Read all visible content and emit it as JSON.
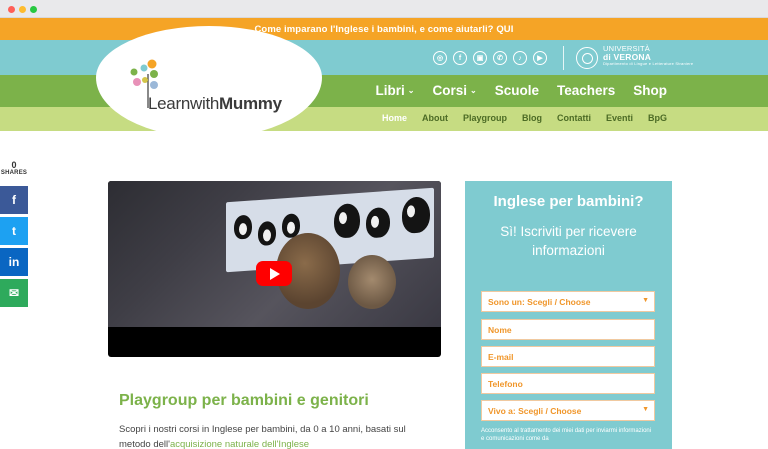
{
  "announcement": {
    "text": "Come imparano l'Inglese i bambini, e come aiutarli? QUI"
  },
  "logo": {
    "word1": "Learn",
    "word2": "with",
    "word3": "Mummy"
  },
  "social_icons": [
    "instagram-icon",
    "facebook-icon",
    "instagram-icon",
    "phone-icon",
    "tiktok-icon",
    "youtube-icon"
  ],
  "university": {
    "line1": "UNIVERSITÀ",
    "line2": "di VERONA",
    "line3": "Dipartimento di Lingue e Letterature Straniere"
  },
  "main_nav": [
    {
      "label": "Libri",
      "has_dropdown": true
    },
    {
      "label": "Corsi",
      "has_dropdown": true
    },
    {
      "label": "Scuole",
      "has_dropdown": false
    },
    {
      "label": "Teachers",
      "has_dropdown": false
    },
    {
      "label": "Shop",
      "has_dropdown": false
    }
  ],
  "sub_nav": [
    {
      "label": "Home",
      "active": true
    },
    {
      "label": "About",
      "active": false
    },
    {
      "label": "Playgroup",
      "active": false
    },
    {
      "label": "Blog",
      "active": false
    },
    {
      "label": "Contatti",
      "active": false
    },
    {
      "label": "Eventi",
      "active": false
    },
    {
      "label": "BpG",
      "active": false
    }
  ],
  "share": {
    "count": "0",
    "label": "SHARES",
    "buttons": [
      {
        "icon": "facebook-icon",
        "glyph": "f"
      },
      {
        "icon": "twitter-icon",
        "glyph": "t"
      },
      {
        "icon": "linkedin-icon",
        "glyph": "in"
      },
      {
        "icon": "email-icon",
        "glyph": "✉"
      }
    ]
  },
  "content": {
    "heading": "Playgroup per bambini e genitori",
    "para_text": "Scopri i nostri corsi in Inglese per bambini, da 0 a 10 anni, basati sul metodo dell'",
    "para_link": "acquisizione naturale dell'Inglese"
  },
  "form": {
    "title": "Inglese per bambini?",
    "subtitle": "Sì! Iscriviti per ricevere informazioni",
    "fields": [
      {
        "label": "Sono un: Scegli / Choose",
        "type": "select"
      },
      {
        "label": "Nome",
        "type": "text"
      },
      {
        "label": "E-mail",
        "type": "text"
      },
      {
        "label": "Telefono",
        "type": "text"
      },
      {
        "label": "Vivo a: Scegli / Choose",
        "type": "select"
      }
    ],
    "consent": "Acconsento al trattamento dei miei dati per inviarmi informazioni e comunicazioni come da"
  },
  "colors": {
    "announce_orange": "#f5a426",
    "teal": "#7fcbd0",
    "green": "#7cb24a",
    "light_green": "#c6dc82",
    "field_text": "#f0962a"
  }
}
